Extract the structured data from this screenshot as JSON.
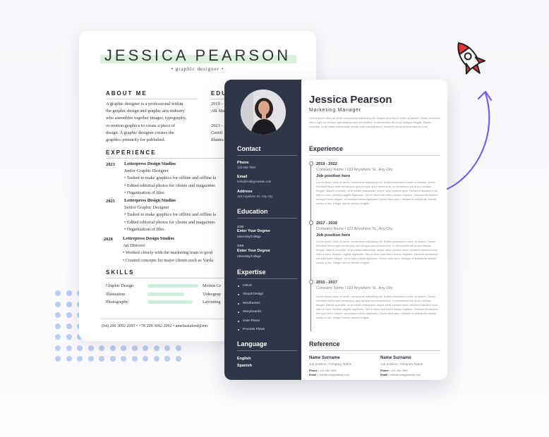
{
  "colors": {
    "sidebar": "#2f3648",
    "accent_green": "#d9f1dc",
    "dots": "#b9cff4",
    "arrow": "#7b5cf0",
    "rocket": "#e8353b"
  },
  "icons": [
    "rocket-icon",
    "curved-arrow-icon",
    "profile-photo"
  ],
  "back_resume": {
    "name": "JESSICA PEARSON",
    "subtitle": "• graphic designer •",
    "about_heading": "ABOUT ME",
    "about_lines": [
      "A graphic designer is a professional within",
      "the graphic design and graphic arts industry",
      "who assembles together images, typography,",
      "or motion graphics to create a piece of",
      "design. A graphic designer creates the",
      "graphics primarily for published."
    ],
    "education_heading": "EDU",
    "education_lines": [
      "2019 –",
      "AR Ma",
      "",
      "2023 –",
      "Certifi",
      "illustra"
    ],
    "experience_heading": "EXPERIENCE",
    "jobs": [
      {
        "year": "2023",
        "company": "Letterpress Design Studios",
        "role": "Junior Graphic Designer",
        "bullets": [
          "• Tasked to make graphics for offline and offline la",
          "• Edited editorial photos for clients and magazines",
          "• Organization of files."
        ]
      },
      {
        "year": "2025",
        "company": "Letterpress Design Studios",
        "role": "Senior Graphic Designer",
        "bullets": [
          "• Tasked to make graphics for offline and offline la",
          "• Edited editorial photos for clients and magazines",
          "• Organization of files."
        ]
      },
      {
        "year": "2028",
        "company": "Letterpress Design Studios",
        "role": "Art Director",
        "bullets": [
          "• Worked closely with the marketing team to prod",
          "• Created concepts for major clients such as Varda"
        ]
      }
    ],
    "skills_heading": "SKILLS",
    "skills": [
      {
        "name": "Graphic Design",
        "level": 0.9
      },
      {
        "name": "Illustration",
        "level": 0.65
      },
      {
        "name": "Photography",
        "level": 0.8
      }
    ],
    "skills_right": [
      "Motion Gr",
      "Videograp",
      "Layouting"
    ],
    "footer": "(04) 290 3092 2093 • +78 209 3092 2092 • ameliastaford@em"
  },
  "front_resume": {
    "name": "Jessica Pearson",
    "title": "Marketing Manager",
    "intro": "Lorem ipsum dolor sit amet, consectetur adipiscing elit. Nullam pharetra in lorem at laoreet. Donec hendrerit libero eget est tempor, quis tempus arcu elementum. In elementum elit at dui tristique feugiat. Mauris convallis, mi at mattis malesuada, neque nulla volutpat dolor, hendrerit faucibus eros nibh ut nunc.",
    "contact_heading": "Contact",
    "phone_label": "Phone",
    "phone": "123-456-7890",
    "email_label": "Email",
    "email": "hello@reallygreatsite.com",
    "address_label": "Address",
    "address": "123 Anywhere St., Any City",
    "education_heading": "Education",
    "education": [
      {
        "year": "2008",
        "degree": "Enter Your Degree",
        "school": "University/College"
      },
      {
        "year": "2008",
        "degree": "Enter Your Degree",
        "school": "University/College"
      }
    ],
    "expertise_heading": "Expertise",
    "expertise": [
      "UI/UX",
      "Visual Design",
      "Wireframes",
      "Storyboards",
      "User Flows",
      "Process Flows"
    ],
    "language_heading": "Language",
    "languages": [
      "English",
      "Spanish"
    ],
    "experience_heading": "Experience",
    "jobs": [
      {
        "years": "2019 - 2022",
        "company": "Company Name I 123 Anywhere St., Any City",
        "position": "Job position here",
        "desc": "Lorem ipsum dolor sit amet, consectetur adipiscing elit. Nullam pharetra in lorem at laoreet. Donec hendrerit libero eget est tempor, quis tempus arcu elementum. In elementum elit at dui tristique feugiat. Mauris convallis, mi at mattis malesuada, neque nulla volutpat dolor, hendrerit faucibus eros nibh ut nunc. Aenean sagittis dignissim. Sed in libero sed libero dictum dapibus. Vivamus fermentum est eget lorem aliquet, vel tempus metus dignissim. Donec risus arcu, tristique et sollicitudin blandit iaculis ut est. Integer rutrum ultrices fringilla."
      },
      {
        "years": "2017 - 2019",
        "company": "Company Name I 123 Anywhere St., Any City",
        "position": "Job position here",
        "desc": "Lorem ipsum dolor sit amet, consectetur adipiscing elit. Nullam pharetra in lorem at laoreet. Donec hendrerit libero eget est tempor, quis tempus arcu elementum. In elementum elit at dui tristique feugiat. Mauris convallis, mi at mattis malesuada, neque nulla volutpat dolor, hendrerit faucibus eros nibh ut nunc. Aenean sagittis dignissim. Sed in libero sed libero dictum dapibus. Vivamus fermentum est eget lorem aliquet, vel tempus metus dignissim. Donec risus arcu, tristique et sollicitudin blandit iaculis ut est. Integer rutrum ultrices fringilla."
      },
      {
        "years": "2015 - 2017",
        "company": "Company Name I 123 Anywhere St., Any City",
        "position": "",
        "desc": "Lorem ipsum dolor sit amet, consectetur adipiscing elit. Nullam pharetra in lorem at laoreet. Donec hendrerit libero eget est tempor, quis tempus arcu elementum. In elementum elit at dui tristique feugiat. Mauris convallis, mi at mattis malesuada, neque nulla volutpat dolor, hendrerit faucibus eros nibh ut nunc. Aenean sagittis dignissim. Sed in libero sed libero dictum dapibus. Vivamus fermentum est eget lorem aliquet, vel tempus metus dignissim. Donec risus arcu, tristique et sollicitudin blandit iaculis ut est. Integer rutrum ultrices fringilla."
      }
    ],
    "reference_heading": "Reference",
    "references": [
      {
        "name": "Name Surname",
        "position": "Job position, Company Name",
        "phone_label": "Phone :",
        "phone": "123-456-7890",
        "email_label": "Email :",
        "email": "hello@reallygreatsite.com"
      },
      {
        "name": "Name Surname",
        "position": "Job position, Company Name",
        "phone_label": "Phone :",
        "phone": "123-456-7890",
        "email_label": "Email :",
        "email": "hello@reallygreatsite.com"
      }
    ]
  }
}
